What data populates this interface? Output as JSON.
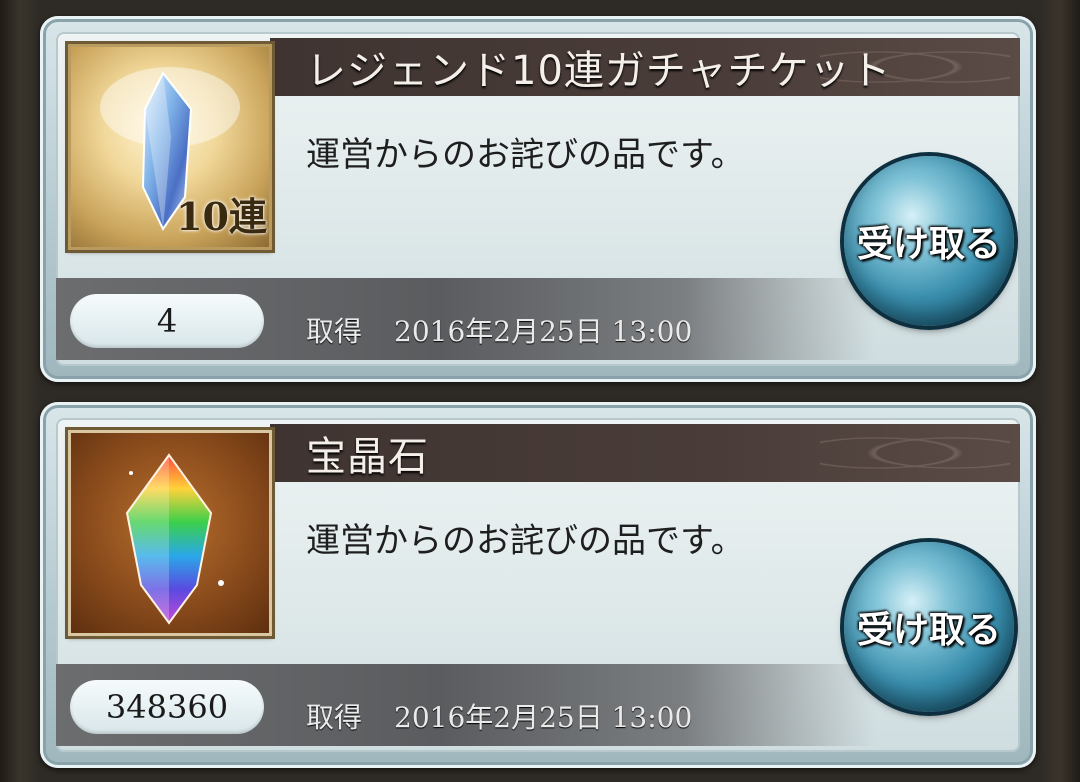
{
  "gifts": [
    {
      "title": "レジェンド10連ガチャチケット",
      "description": "運営からのお詫びの品です。",
      "thumbnail_badge": "10連",
      "thumbnail_icon": "crystal-ticket-icon",
      "count": "4",
      "acquired_label": "取得",
      "acquired_date": "2016年2月25日 13:00",
      "claim_label": "受け取る"
    },
    {
      "title": "宝晶石",
      "description": "運営からのお詫びの品です。",
      "thumbnail_icon": "rainbow-crystal-icon",
      "count": "348360",
      "acquired_label": "取得",
      "acquired_date": "2016年2月25日 13:00",
      "claim_label": "受け取る"
    }
  ]
}
